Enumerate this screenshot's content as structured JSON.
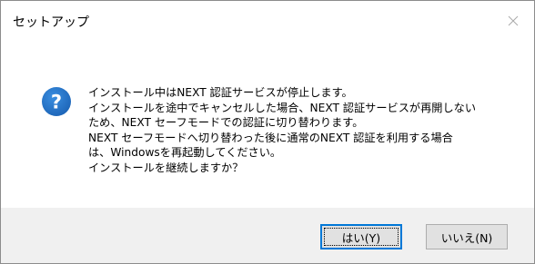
{
  "window": {
    "title": "セットアップ",
    "close_icon": "close-icon"
  },
  "message": {
    "icon": "question-icon",
    "icon_color": "#1c64b7",
    "lines": [
      "インストール中はNEXT 認証サービスが停止します。",
      "インストールを途中でキャンセルした場合、NEXT 認証サービスが再開しない",
      "ため、NEXT セーフモードでの認証に切り替わります。",
      "NEXT セーフモードへ切り替わった後に通常のNEXT 認証を利用する場合",
      "は、Windowsを再起動してください。",
      "インストールを継続しますか？"
    ]
  },
  "buttons": {
    "yes_label": "はい(Y)",
    "no_label": "いいえ(N)"
  },
  "colors": {
    "footer_bg": "#f0f0f0",
    "focus_border": "#0078d7",
    "button_bg": "#e1e1e1"
  }
}
